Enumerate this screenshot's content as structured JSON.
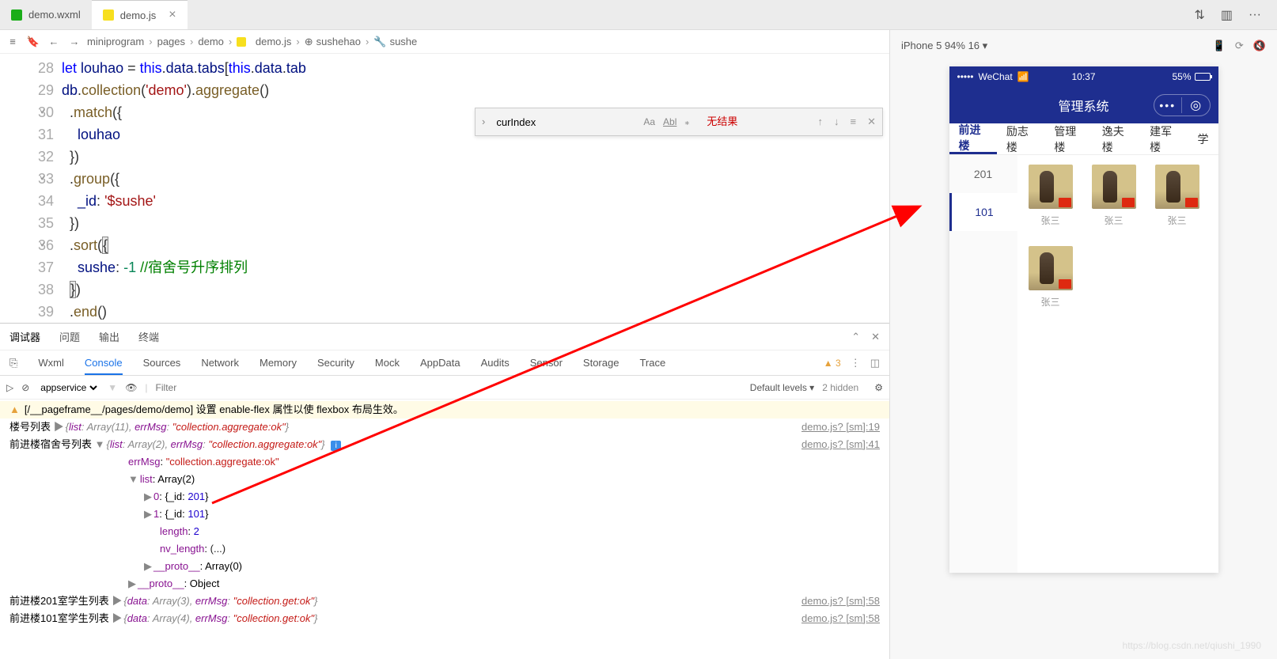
{
  "tabs": [
    {
      "icon": "wxml",
      "label": "demo.wxml",
      "active": false
    },
    {
      "icon": "js",
      "label": "demo.js",
      "active": true
    }
  ],
  "device_selector": "iPhone 5 94% 16 ▾",
  "breadcrumb": [
    "miniprogram",
    "pages",
    "demo",
    "demo.js",
    "sushehao",
    "sushe"
  ],
  "code_start_line": 28,
  "code_lines": [
    "let louhao = this.data.tabs[this.data.tab",
    "db.collection('demo').aggregate()",
    "  .match({",
    "    louhao",
    "  })",
    "  .group({",
    "    _id: '$sushe'",
    "  })",
    "  .sort({",
    "    sushe: -1 //宿舍号升序排列",
    "  })",
    "  .end()"
  ],
  "find": {
    "value": "curIndex",
    "opts": [
      "Aa",
      "Abl",
      "⁎"
    ],
    "no_result": "无结果"
  },
  "debug_tabs": [
    "调试器",
    "问题",
    "输出",
    "终端"
  ],
  "devtools_tabs": [
    "Wxml",
    "Console",
    "Sources",
    "Network",
    "Memory",
    "Security",
    "Mock",
    "AppData",
    "Audits",
    "Sensor",
    "Storage",
    "Trace"
  ],
  "devtools_active": "Console",
  "warning_count": "3",
  "console_toolbar": {
    "scope": "appservice",
    "filter_placeholder": "Filter",
    "levels": "Default levels ▾",
    "hidden": "2 hidden"
  },
  "console": {
    "warn_line": "[/__pageframe__/pages/demo/demo] 设置 enable-flex 属性以使 flexbox 布局生效。",
    "line1_label": "楼号列表",
    "line1_obj": "{list: Array(11), errMsg: \"collection.aggregate:ok\"}",
    "line1_src": "demo.js? [sm]:19",
    "line2_label": "前进楼宿舍号列表",
    "line2_obj": "{list: Array(2), errMsg: \"collection.aggregate:ok\"}",
    "line2_src": "demo.js? [sm]:41",
    "errMsg_val": "\"collection.aggregate:ok\"",
    "list_label": "list: Array(2)",
    "item0": "0: {_id: 201}",
    "item1": "1: {_id: 101}",
    "length": "length: 2",
    "nv_length": "nv_length: (...)",
    "proto_arr": "__proto__: Array(0)",
    "proto_obj": "__proto__: Object",
    "line3_label": "前进楼201室学生列表",
    "line3_obj": "{data: Array(3), errMsg: \"collection.get:ok\"}",
    "line3_src": "demo.js? [sm]:58",
    "line4_label": "前进楼101室学生列表",
    "line4_obj": "{data: Array(4), errMsg: \"collection.get:ok\"}",
    "line4_src": "demo.js? [sm]:58"
  },
  "phone": {
    "carrier": "WeChat",
    "time": "10:37",
    "battery": "55%",
    "title": "管理系统",
    "tabs": [
      "前进楼",
      "励志楼",
      "管理楼",
      "逸夫楼",
      "建军楼",
      "学"
    ],
    "active_tab": 0,
    "side_nums": [
      "201",
      "101"
    ],
    "active_side": 1,
    "person_name": "张三",
    "person_count": 4
  },
  "watermark": "https://blog.csdn.net/qiushi_1990"
}
